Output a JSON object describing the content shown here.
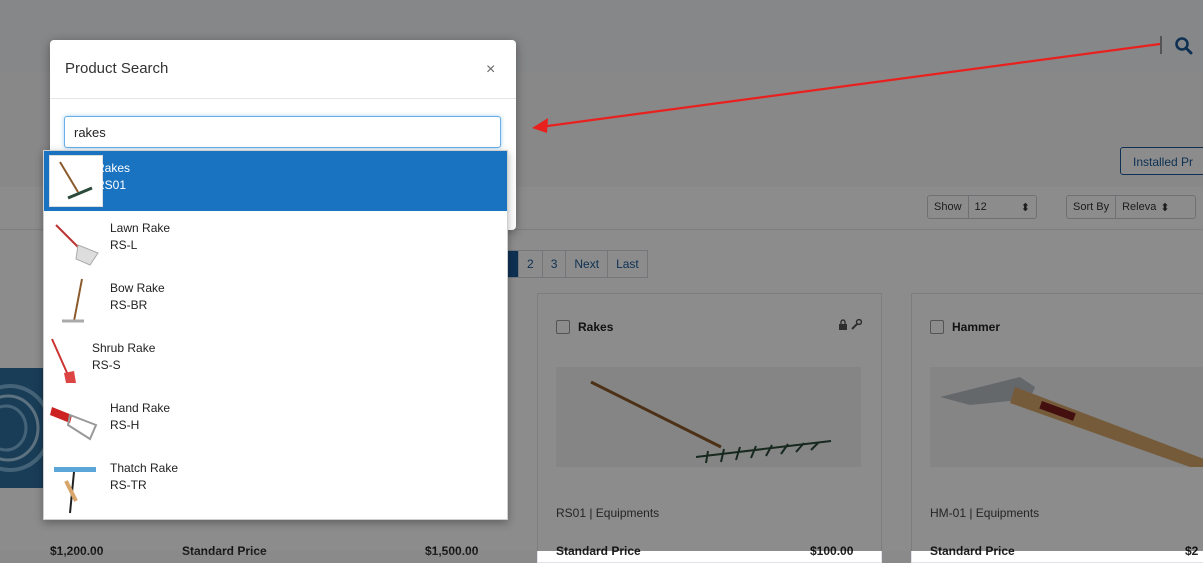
{
  "background": {
    "pager": [
      "2",
      "3",
      "Next",
      "Last"
    ],
    "installed_button": "Installed Pr",
    "show_label": "Show",
    "show_value": "12",
    "sort_label": "Sort By",
    "sort_value": "Releva",
    "cards": [
      {
        "title": "Rakes",
        "meta": "RS01 | Equipments",
        "price_label": "Standard Price",
        "price": "$100.00"
      },
      {
        "title": "Hammer",
        "meta": "HM-01 | Equipments",
        "price_label": "Standard Price",
        "price": "$2"
      }
    ],
    "left_prices": [
      {
        "label": "",
        "value": "$1,200.00"
      },
      {
        "label": "Standard Price",
        "value": "$1,500.00"
      }
    ]
  },
  "modal": {
    "title": "Product Search",
    "close": "×",
    "search_value": "rakes",
    "results": [
      {
        "name": "Rakes",
        "code": "RS01",
        "selected": true
      },
      {
        "name": "Lawn Rake",
        "code": "RS-L",
        "selected": false
      },
      {
        "name": "Bow Rake",
        "code": "RS-BR",
        "selected": false
      },
      {
        "name": "Shrub Rake",
        "code": "RS-S",
        "selected": false
      },
      {
        "name": "Hand Rake",
        "code": "RS-H",
        "selected": false
      },
      {
        "name": "Thatch Rake",
        "code": "RS-TR",
        "selected": false
      }
    ]
  },
  "colors": {
    "accent": "#1b5a97",
    "selected": "#1a73c0",
    "annotation": "#e8201e"
  },
  "icons": [
    "search-icon",
    "lock-icon",
    "wrench-icon",
    "close-icon",
    "sort-caret-icon"
  ]
}
